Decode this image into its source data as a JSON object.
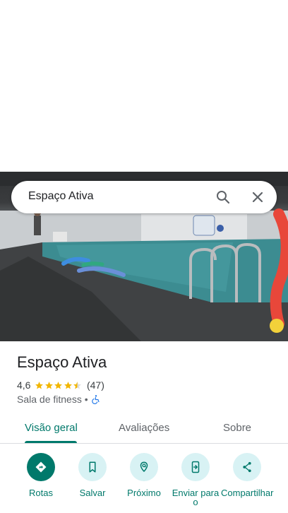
{
  "search": {
    "query": "Espaço Ativa"
  },
  "place": {
    "title": "Espaço Ativa",
    "rating": "4,6",
    "stars_filled": 4.5,
    "reviews": "(47)",
    "category": "Sala de fitness •"
  },
  "tabs": [
    {
      "label": "Visão geral",
      "active": true
    },
    {
      "label": "Avaliações",
      "active": false
    },
    {
      "label": "Sobre",
      "active": false
    }
  ],
  "actions": [
    {
      "label": "Rotas",
      "icon": "directions-icon",
      "primary": true
    },
    {
      "label": "Salvar",
      "icon": "bookmark-icon",
      "primary": false
    },
    {
      "label": "Próximo",
      "icon": "nearby-icon",
      "primary": false
    },
    {
      "label": "Enviar para o",
      "icon": "send-to-phone-icon",
      "primary": false
    },
    {
      "label": "Compartilhar",
      "icon": "share-icon",
      "primary": false
    }
  ],
  "colors": {
    "accent": "#00796b",
    "action_bg": "#d8f2f4",
    "star": "#f2b600"
  }
}
